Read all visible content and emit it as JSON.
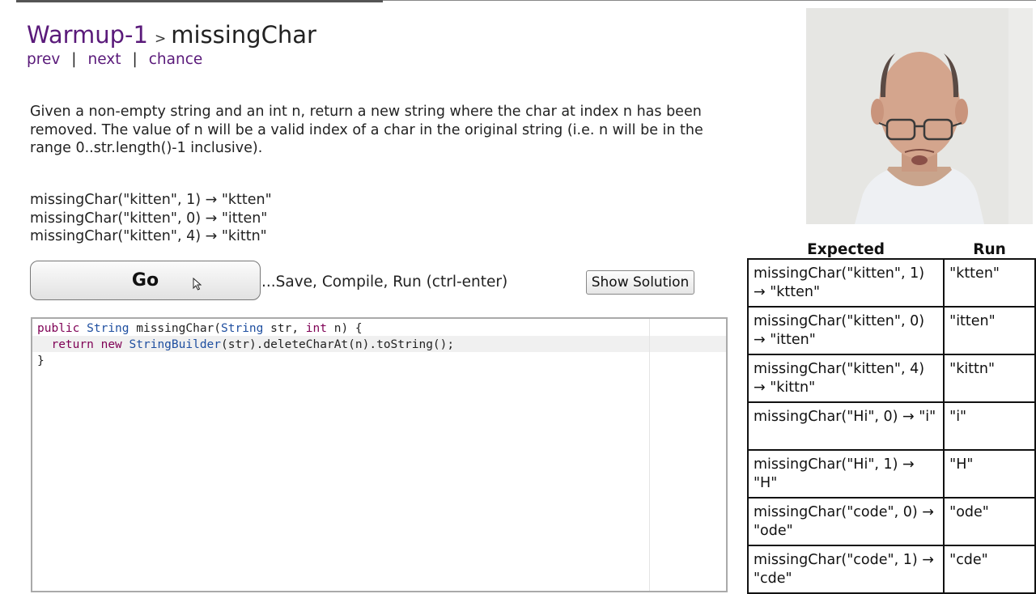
{
  "header": {
    "section": "Warmup-1",
    "separator": ">",
    "problem": "missingChar"
  },
  "nav": {
    "prev": "prev",
    "next": "next",
    "chance": "chance",
    "divider": "|"
  },
  "description": "Given a non-empty string and an int n, return a new string where the char at index n has been removed. The value of n will be a valid index of a char in the original string (i.e. n will be in the range 0..str.length()-1 inclusive).",
  "examples": [
    "missingChar(\"kitten\", 1) → \"ktten\"",
    "missingChar(\"kitten\", 0) → \"itten\"",
    "missingChar(\"kitten\", 4) → \"kittn\""
  ],
  "controls": {
    "go_label": "Go",
    "run_hint": "...Save, Compile, Run (ctrl-enter)",
    "solution_label": "Show Solution"
  },
  "editor": {
    "lines": [
      "public String missingChar(String str, int n) {",
      "  return new StringBuilder(str).deleteCharAt(n).toString();",
      "}"
    ]
  },
  "results": {
    "headers": {
      "expected": "Expected",
      "run": "Run"
    },
    "rows": [
      {
        "expected": "missingChar(\"kitten\", 1) → \"ktten\"",
        "run": "\"ktten\""
      },
      {
        "expected": "missingChar(\"kitten\", 0) → \"itten\"",
        "run": "\"itten\""
      },
      {
        "expected": "missingChar(\"kitten\", 4) → \"kittn\"",
        "run": "\"kittn\""
      },
      {
        "expected": "missingChar(\"Hi\", 0) → \"i\"",
        "run": "\"i\""
      },
      {
        "expected": "missingChar(\"Hi\", 1) → \"H\"",
        "run": "\"H\""
      },
      {
        "expected": "missingChar(\"code\", 0) → \"ode\"",
        "run": "\"ode\""
      },
      {
        "expected": "missingChar(\"code\", 1) → \"cde\"",
        "run": "\"cde\""
      }
    ]
  },
  "icons": {
    "cursor": "pointer-cursor-icon"
  },
  "colors": {
    "link": "#5a1a7a",
    "keyword": "#7f0055",
    "type": "#1f4fa0",
    "table_border": "#111111"
  }
}
